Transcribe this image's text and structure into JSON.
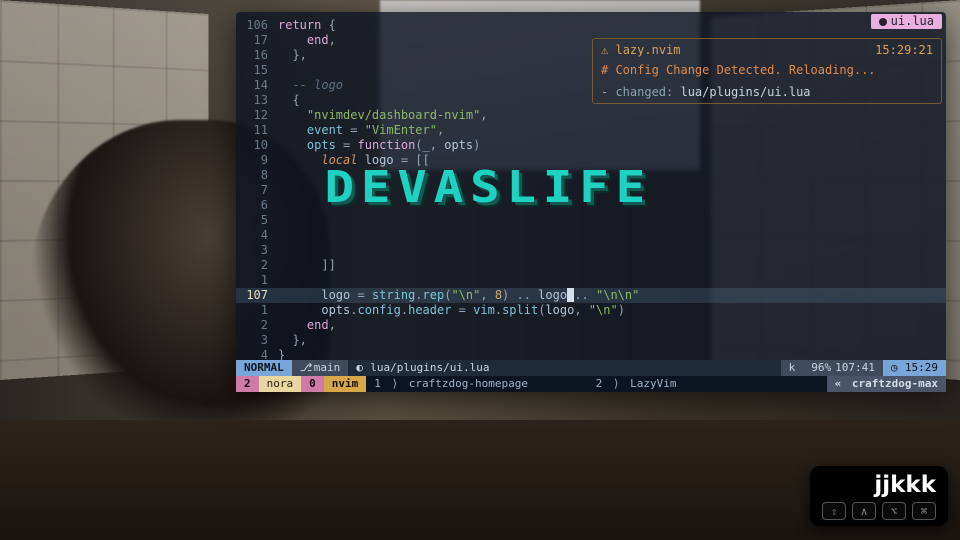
{
  "tab": {
    "filename": "ui.lua"
  },
  "code": {
    "lines": [
      {
        "n": "106",
        "cur": false,
        "segs": [
          {
            "t": "return",
            "c": "keyword"
          },
          {
            "t": " {",
            "c": "punct"
          }
        ]
      },
      {
        "n": "17",
        "cur": false,
        "segs": [
          {
            "t": "    end",
            "c": "keyword"
          },
          {
            "t": ",",
            "c": "punct"
          }
        ]
      },
      {
        "n": "16",
        "cur": false,
        "segs": [
          {
            "t": "  },",
            "c": "punct"
          }
        ]
      },
      {
        "n": "15",
        "cur": false,
        "segs": []
      },
      {
        "n": "14",
        "cur": false,
        "segs": [
          {
            "t": "  -- logo",
            "c": "comment"
          }
        ]
      },
      {
        "n": "13",
        "cur": false,
        "segs": [
          {
            "t": "  {",
            "c": "punct"
          }
        ]
      },
      {
        "n": "12",
        "cur": false,
        "segs": [
          {
            "t": "    ",
            "c": ""
          },
          {
            "t": "\"nvimdev/dashboard-nvim\"",
            "c": "string"
          },
          {
            "t": ",",
            "c": "punct"
          }
        ]
      },
      {
        "n": "11",
        "cur": false,
        "segs": [
          {
            "t": "    ",
            "c": ""
          },
          {
            "t": "event",
            "c": "prop"
          },
          {
            "t": " = ",
            "c": "punct"
          },
          {
            "t": "\"VimEnter\"",
            "c": "string"
          },
          {
            "t": ",",
            "c": "punct"
          }
        ]
      },
      {
        "n": "10",
        "cur": false,
        "segs": [
          {
            "t": "    ",
            "c": ""
          },
          {
            "t": "opts",
            "c": "prop"
          },
          {
            "t": " = ",
            "c": "punct"
          },
          {
            "t": "function",
            "c": "keyword"
          },
          {
            "t": "(",
            "c": "punct"
          },
          {
            "t": "_",
            "c": "ident"
          },
          {
            "t": ", ",
            "c": "punct"
          },
          {
            "t": "opts",
            "c": "ident"
          },
          {
            "t": ")",
            "c": "punct"
          }
        ]
      },
      {
        "n": "9",
        "cur": false,
        "segs": [
          {
            "t": "      ",
            "c": ""
          },
          {
            "t": "local",
            "c": "locol"
          },
          {
            "t": " logo ",
            "c": "ident"
          },
          {
            "t": "= [[",
            "c": "punct"
          }
        ]
      },
      {
        "n": "8",
        "cur": false,
        "segs": []
      },
      {
        "n": "7",
        "cur": false,
        "segs": []
      },
      {
        "n": "6",
        "cur": false,
        "segs": []
      },
      {
        "n": "5",
        "cur": false,
        "segs": []
      },
      {
        "n": "4",
        "cur": false,
        "segs": []
      },
      {
        "n": "3",
        "cur": false,
        "segs": []
      },
      {
        "n": "2",
        "cur": false,
        "segs": [
          {
            "t": "      ]]",
            "c": "punct"
          }
        ]
      },
      {
        "n": "1",
        "cur": false,
        "segs": []
      },
      {
        "n": "107",
        "cur": true,
        "segs": [
          {
            "t": "      logo ",
            "c": "ident"
          },
          {
            "t": "= ",
            "c": "punct"
          },
          {
            "t": "string",
            "c": "fn"
          },
          {
            "t": ".",
            "c": "punct"
          },
          {
            "t": "rep",
            "c": "fn"
          },
          {
            "t": "(",
            "c": "punct"
          },
          {
            "t": "\"\\n\"",
            "c": "string"
          },
          {
            "t": ", ",
            "c": "punct"
          },
          {
            "t": "8",
            "c": "num"
          },
          {
            "t": ") .. ",
            "c": "punct"
          },
          {
            "t": "logo",
            "c": "ident"
          },
          {
            "t": " ",
            "c": "cursor-block"
          },
          {
            "t": ".. ",
            "c": "punct"
          },
          {
            "t": "\"\\n\\n\"",
            "c": "string"
          }
        ]
      },
      {
        "n": "1",
        "cur": false,
        "segs": [
          {
            "t": "      ",
            "c": ""
          },
          {
            "t": "opts",
            "c": "ident"
          },
          {
            "t": ".",
            "c": "punct"
          },
          {
            "t": "config",
            "c": "prop"
          },
          {
            "t": ".",
            "c": "punct"
          },
          {
            "t": "header",
            "c": "prop"
          },
          {
            "t": " = ",
            "c": "punct"
          },
          {
            "t": "vim",
            "c": "fn"
          },
          {
            "t": ".",
            "c": "punct"
          },
          {
            "t": "split",
            "c": "fn"
          },
          {
            "t": "(",
            "c": "punct"
          },
          {
            "t": "logo",
            "c": "ident"
          },
          {
            "t": ", ",
            "c": "punct"
          },
          {
            "t": "\"\\n\"",
            "c": "string"
          },
          {
            "t": ")",
            "c": "punct"
          }
        ]
      },
      {
        "n": "2",
        "cur": false,
        "segs": [
          {
            "t": "    ",
            "c": ""
          },
          {
            "t": "end",
            "c": "keyword"
          },
          {
            "t": ",",
            "c": "punct"
          }
        ]
      },
      {
        "n": "3",
        "cur": false,
        "segs": [
          {
            "t": "  },",
            "c": "punct"
          }
        ]
      },
      {
        "n": "4",
        "cur": false,
        "segs": [
          {
            "t": "}",
            "c": "punct"
          }
        ]
      }
    ]
  },
  "notify": {
    "plugin": "lazy.nvim",
    "time": "15:29:21",
    "headline": "# Config Change Detected. Reloading...",
    "changed_label": "changed",
    "changed_file": "lua/plugins/ui.lua"
  },
  "ascii_art": "DEVASLIFE",
  "status1": {
    "mode": "NORMAL",
    "branch": "main",
    "filepath": "lua/plugins/ui.lua",
    "right_key": "k",
    "percent": "96%",
    "pos": "107:41",
    "clock": "15:29"
  },
  "status2": {
    "session_num": "2",
    "session_name": "nora",
    "window_num": "0",
    "process": "nvim",
    "pane1_num": "1",
    "pane1_name": "craftzdog-homepage",
    "pane2_num": "2",
    "pane2_name": "LazyVim",
    "host": "craftzdog-max"
  },
  "keycast": {
    "typed": "jjkkk",
    "mods": [
      "⇧",
      "∧",
      "⌥",
      "⌘"
    ]
  }
}
